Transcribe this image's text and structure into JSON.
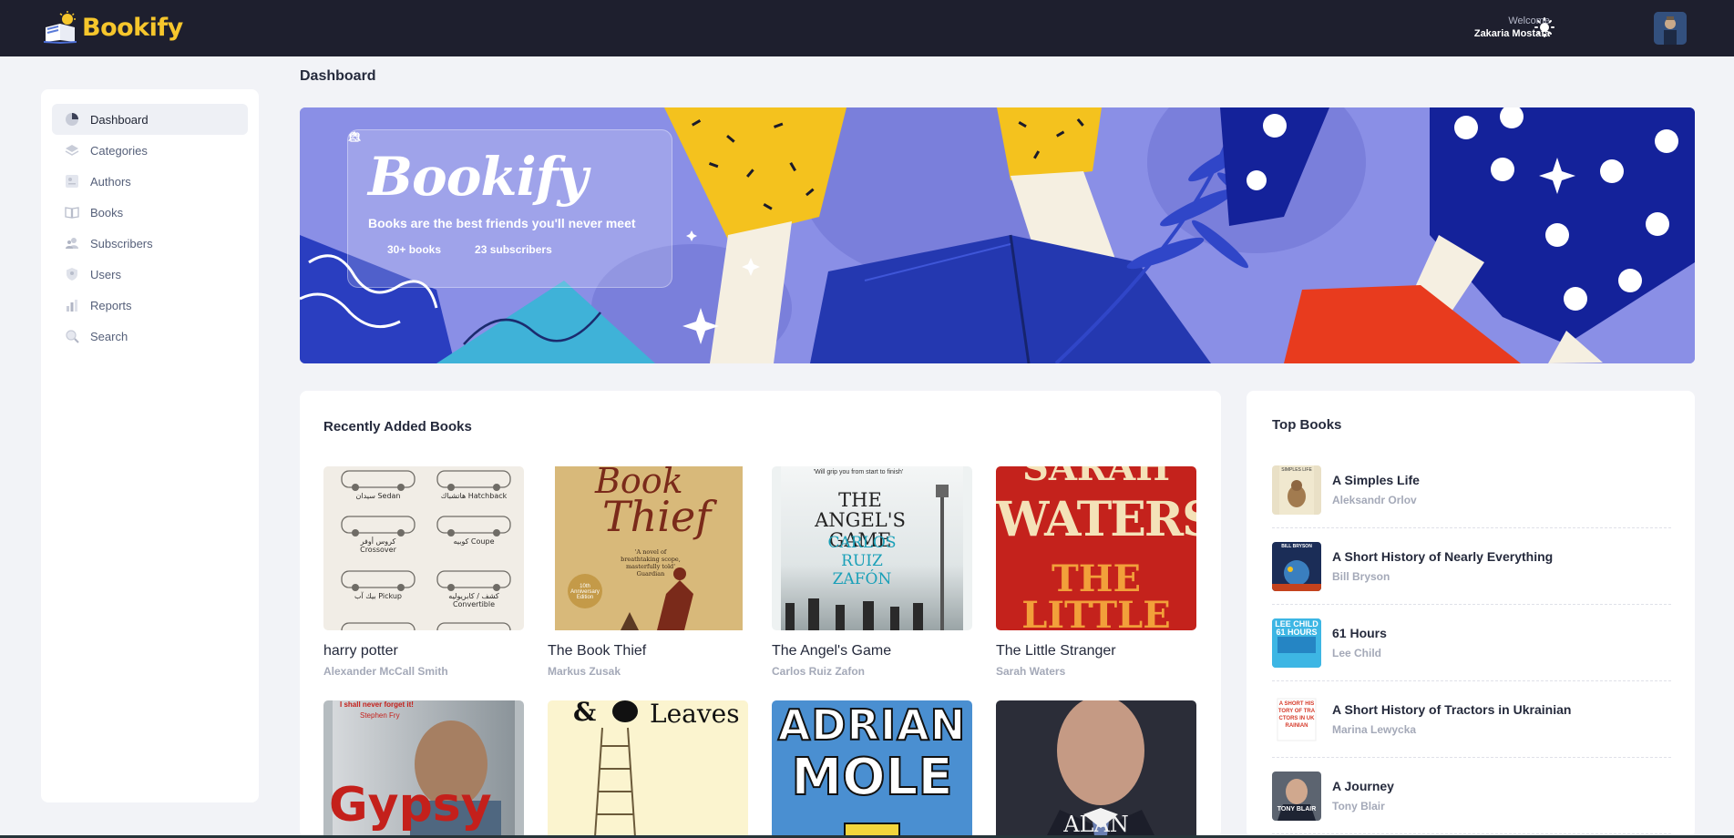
{
  "app": {
    "brand": "Bookify",
    "welcome_label": "Welcome",
    "user_name": "Zakaria Mostafa"
  },
  "sidebar": {
    "items": [
      {
        "label": "Dashboard",
        "icon": "pie-chart-icon",
        "active": true
      },
      {
        "label": "Categories",
        "icon": "layers-icon"
      },
      {
        "label": "Authors",
        "icon": "authors-icon"
      },
      {
        "label": "Books",
        "icon": "book-open-icon"
      },
      {
        "label": "Subscribers",
        "icon": "subscribers-icon"
      },
      {
        "label": "Users",
        "icon": "users-icon"
      },
      {
        "label": "Reports",
        "icon": "bar-chart-icon"
      },
      {
        "label": "Search",
        "icon": "search-icon"
      }
    ]
  },
  "page": {
    "title": "Dashboard"
  },
  "hero": {
    "brand": "Bookify",
    "tagline": "Books are the best friends you'll never meet",
    "books_stat": "30+ books",
    "subscribers_stat": "23 subscribers"
  },
  "recent": {
    "title": "Recently Added Books",
    "books": [
      {
        "title": "harry potter",
        "author": "Alexander McCall Smith",
        "cover_text": [
          "سيدان Sedan",
          "هاتشباك Hatchback",
          "كروس أوفر Crossover",
          "كوبيه Coupe",
          "بيك آب Pickup",
          "كشف / كابريوليه Convertible"
        ]
      },
      {
        "title": "The Book Thief",
        "author": "Markus Zusak",
        "cover_text": [
          "Book",
          "Thief",
          "'A novel of breathtaking scope, masterfully told' Guardian",
          "10th Anniversary Edition"
        ]
      },
      {
        "title": "The Angel's Game",
        "author": "Carlos Ruiz Zafon",
        "cover_text": [
          "'Will grip you from start to finish'",
          "THE ANGEL'S GAME",
          "CARLOS RUIZ ZAFÓN"
        ]
      },
      {
        "title": "The Little Stranger",
        "author": "Sarah Waters",
        "cover_text": [
          "SARAH",
          "WATERS",
          "THE LITTLE"
        ]
      },
      {
        "title": "",
        "author": "",
        "cover_text": [
          "I shall never forget it!",
          "Stephen Fry",
          "Gypsy"
        ]
      },
      {
        "title": "",
        "author": "",
        "cover_text": [
          "&",
          "Leaves"
        ]
      },
      {
        "title": "",
        "author": "",
        "cover_text": [
          "ADRIAN",
          "MOLE"
        ]
      },
      {
        "title": "",
        "author": "",
        "cover_text": [
          "ALAN"
        ]
      }
    ]
  },
  "top": {
    "title": "Top Books",
    "books": [
      {
        "title": "A Simples Life",
        "author": "Aleksandr Orlov",
        "thumb_text": "SIMPLES LIFE"
      },
      {
        "title": "A Short History of Nearly Everything",
        "author": "Bill Bryson",
        "thumb_text": "BILL BRYSON"
      },
      {
        "title": "61 Hours",
        "author": "Lee Child",
        "thumb_text": "LEE CHILD 61 HOURS"
      },
      {
        "title": "A Short History of Tractors in Ukrainian",
        "author": "Marina Lewycka",
        "thumb_text": "A SHORT HISTORY OF TRACTORS IN UKRAINIAN"
      },
      {
        "title": "A Journey",
        "author": "Tony Blair",
        "thumb_text": "TONY BLAIR"
      }
    ]
  },
  "colors": {
    "topbar": "#1e1f2e",
    "brand_yellow": "#f6c62c",
    "hero_bg": "#8a8fe6",
    "page_bg": "#f2f3f7"
  }
}
